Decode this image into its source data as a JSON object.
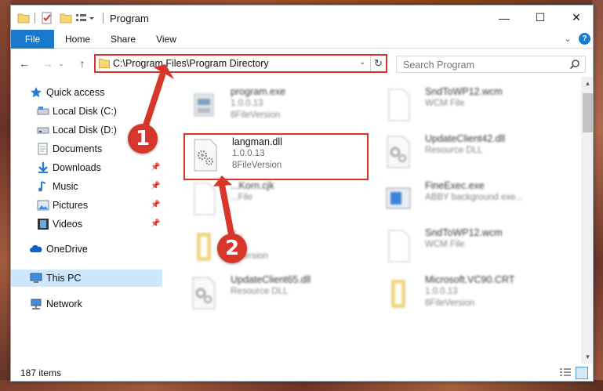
{
  "window": {
    "title": "Program",
    "controls": {
      "minimize": "—",
      "maximize": "☐",
      "close": "✕"
    }
  },
  "ribbon": {
    "tabs": [
      {
        "label": "File",
        "active": true
      },
      {
        "label": "Home"
      },
      {
        "label": "Share"
      },
      {
        "label": "View"
      }
    ],
    "help": "?"
  },
  "nav": {
    "address": "C:\\Program Files\\Program Directory",
    "search_placeholder": "Search Program"
  },
  "sidebar": {
    "items": [
      {
        "label": "Quick access",
        "icon": "star-icon"
      },
      {
        "label": "Local Disk (C:)",
        "icon": "drive-icon"
      },
      {
        "label": "Local Disk (D:)",
        "icon": "drive-icon"
      },
      {
        "label": "Documents",
        "icon": "documents-icon"
      },
      {
        "label": "Downloads",
        "icon": "downloads-icon",
        "pinned": true
      },
      {
        "label": "Music",
        "icon": "music-icon",
        "pinned": true
      },
      {
        "label": "Pictures",
        "icon": "pictures-icon",
        "pinned": true
      },
      {
        "label": "Videos",
        "icon": "videos-icon",
        "pinned": true
      },
      {
        "label": "OneDrive",
        "icon": "cloud-icon"
      },
      {
        "label": "This PC",
        "icon": "computer-icon",
        "selected": true
      },
      {
        "label": "Network",
        "icon": "network-icon"
      }
    ]
  },
  "files": [
    {
      "name": "program.exe",
      "line1": "1.0.0.13",
      "line2": "8FileVersion",
      "icon": "exe-icon",
      "blurred": true
    },
    {
      "name": "SndToWP12.wcm",
      "line1": "WCM File",
      "line2": "",
      "icon": "blank-file-icon",
      "blurred": true
    },
    {
      "name": "langman.dll",
      "line1": "1.0.0.13",
      "line2": "8FileVersion",
      "icon": "dll-gear-icon",
      "blurred": false
    },
    {
      "name": "UpdateClient42.dll",
      "line1": "Resource DLL",
      "line2": "",
      "icon": "dll-gear-icon",
      "blurred": true
    },
    {
      "name": "...Korn.cjk",
      "line1": "...File",
      "line2": "",
      "icon": "blank-file-icon",
      "blurred": true
    },
    {
      "name": "FineExec.exe",
      "line1": "ABBY background exe...",
      "line2": "",
      "icon": "window-app-icon",
      "blurred": true
    },
    {
      "name": "v...",
      "line1": "",
      "line2": "...Version",
      "icon": "folder-file-icon",
      "blurred": true
    },
    {
      "name": "SndToWP12.wcm",
      "line1": "WCM File",
      "line2": "",
      "icon": "blank-file-icon",
      "blurred": true
    },
    {
      "name": "UpdateClient65.dll",
      "line1": "Resource DLL",
      "line2": "",
      "icon": "dll-gear-icon",
      "blurred": true
    },
    {
      "name": "Microsoft.VC90.CRT",
      "line1": "1.0.0.13",
      "line2": "8FileVersion",
      "icon": "folder-file-icon",
      "blurred": true
    }
  ],
  "status": {
    "count": "187 items"
  },
  "annotations": {
    "step1": "1",
    "step2": "2"
  },
  "colors": {
    "accent": "#1979ca",
    "highlight": "#d9362b",
    "selected": "#cce8ff"
  }
}
